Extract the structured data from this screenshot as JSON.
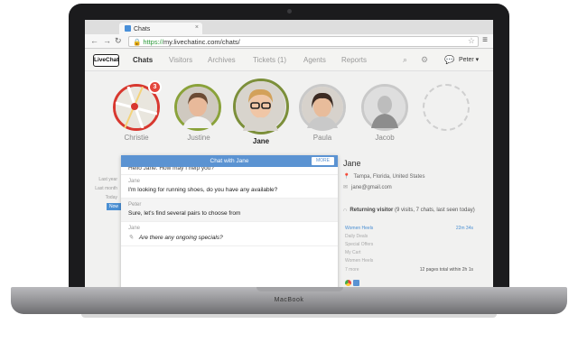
{
  "browser": {
    "tab_title": "Chats",
    "url_scheme": "https://",
    "url_rest": "my.livechatinc.com/chats/"
  },
  "app": {
    "logo": "LiveChat",
    "nav": [
      "Chats",
      "Visitors",
      "Archives",
      "Tickets (1)",
      "Agents",
      "Reports"
    ],
    "user": "Peter"
  },
  "visitors": [
    {
      "name": "Christie",
      "badge": "3"
    },
    {
      "name": "Justine"
    },
    {
      "name": "Jane"
    },
    {
      "name": "Paula"
    },
    {
      "name": "Jacob"
    }
  ],
  "timeline": [
    "Last year",
    "Last month",
    "Today",
    "Now"
  ],
  "chat": {
    "title": "Chat with Jane",
    "more": "MORE",
    "cut_line": "Hello Jane. How may I help you?",
    "messages": [
      {
        "author": "Jane",
        "text": "I'm looking for running shoes, do you have any available?"
      },
      {
        "author": "Peter",
        "text": "Sure, let's find several pairs to choose from"
      },
      {
        "author": "Jane",
        "text": "Are there any ongoing specials?"
      }
    ]
  },
  "details": {
    "name": "Jane",
    "location": "Tampa, Florida, United States",
    "email": "jane@gmail.com",
    "returning_label": "Returning visitor",
    "returning_info": "(9 visits, 7 chats, last seen today)",
    "pages": [
      "Women Heels",
      "Daily Deals",
      "Special Offers",
      "My Cart",
      "Women Heels",
      "7 more"
    ],
    "first_page_time": "22m 34s",
    "pages_summary": "12 pages total within 2h 1s"
  },
  "laptop": {
    "brand": "MacBook"
  },
  "colors": {
    "accent": "#5b93d2",
    "badge": "#e4463c",
    "ring_selected": "#7c8f3a"
  }
}
